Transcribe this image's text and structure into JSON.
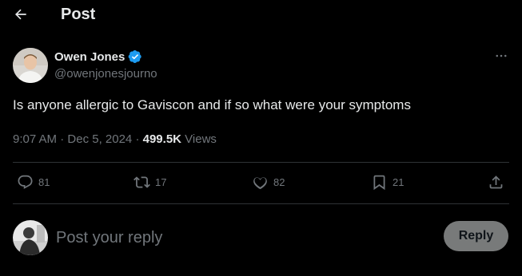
{
  "header": {
    "title": "Post",
    "back_icon": "arrow-left-icon"
  },
  "post": {
    "author": {
      "name": "Owen Jones",
      "handle": "@owenjonesjourno",
      "verified": true
    },
    "text": "Is anyone allergic to Gaviscon and if so what were your symptoms",
    "time": "9:07 AM",
    "date": "Dec 5, 2024",
    "views_count": "499.5K",
    "views_label": "Views"
  },
  "actions": {
    "replies": "81",
    "reposts": "17",
    "likes": "82",
    "bookmarks": "21"
  },
  "reply_box": {
    "placeholder": "Post your reply",
    "button_label": "Reply"
  },
  "colors": {
    "background": "#000000",
    "text": "#e7e9ea",
    "muted": "#71767b",
    "divider": "#2f3336",
    "verified": "#1d9bf0",
    "reply_button": "#787a7a"
  }
}
